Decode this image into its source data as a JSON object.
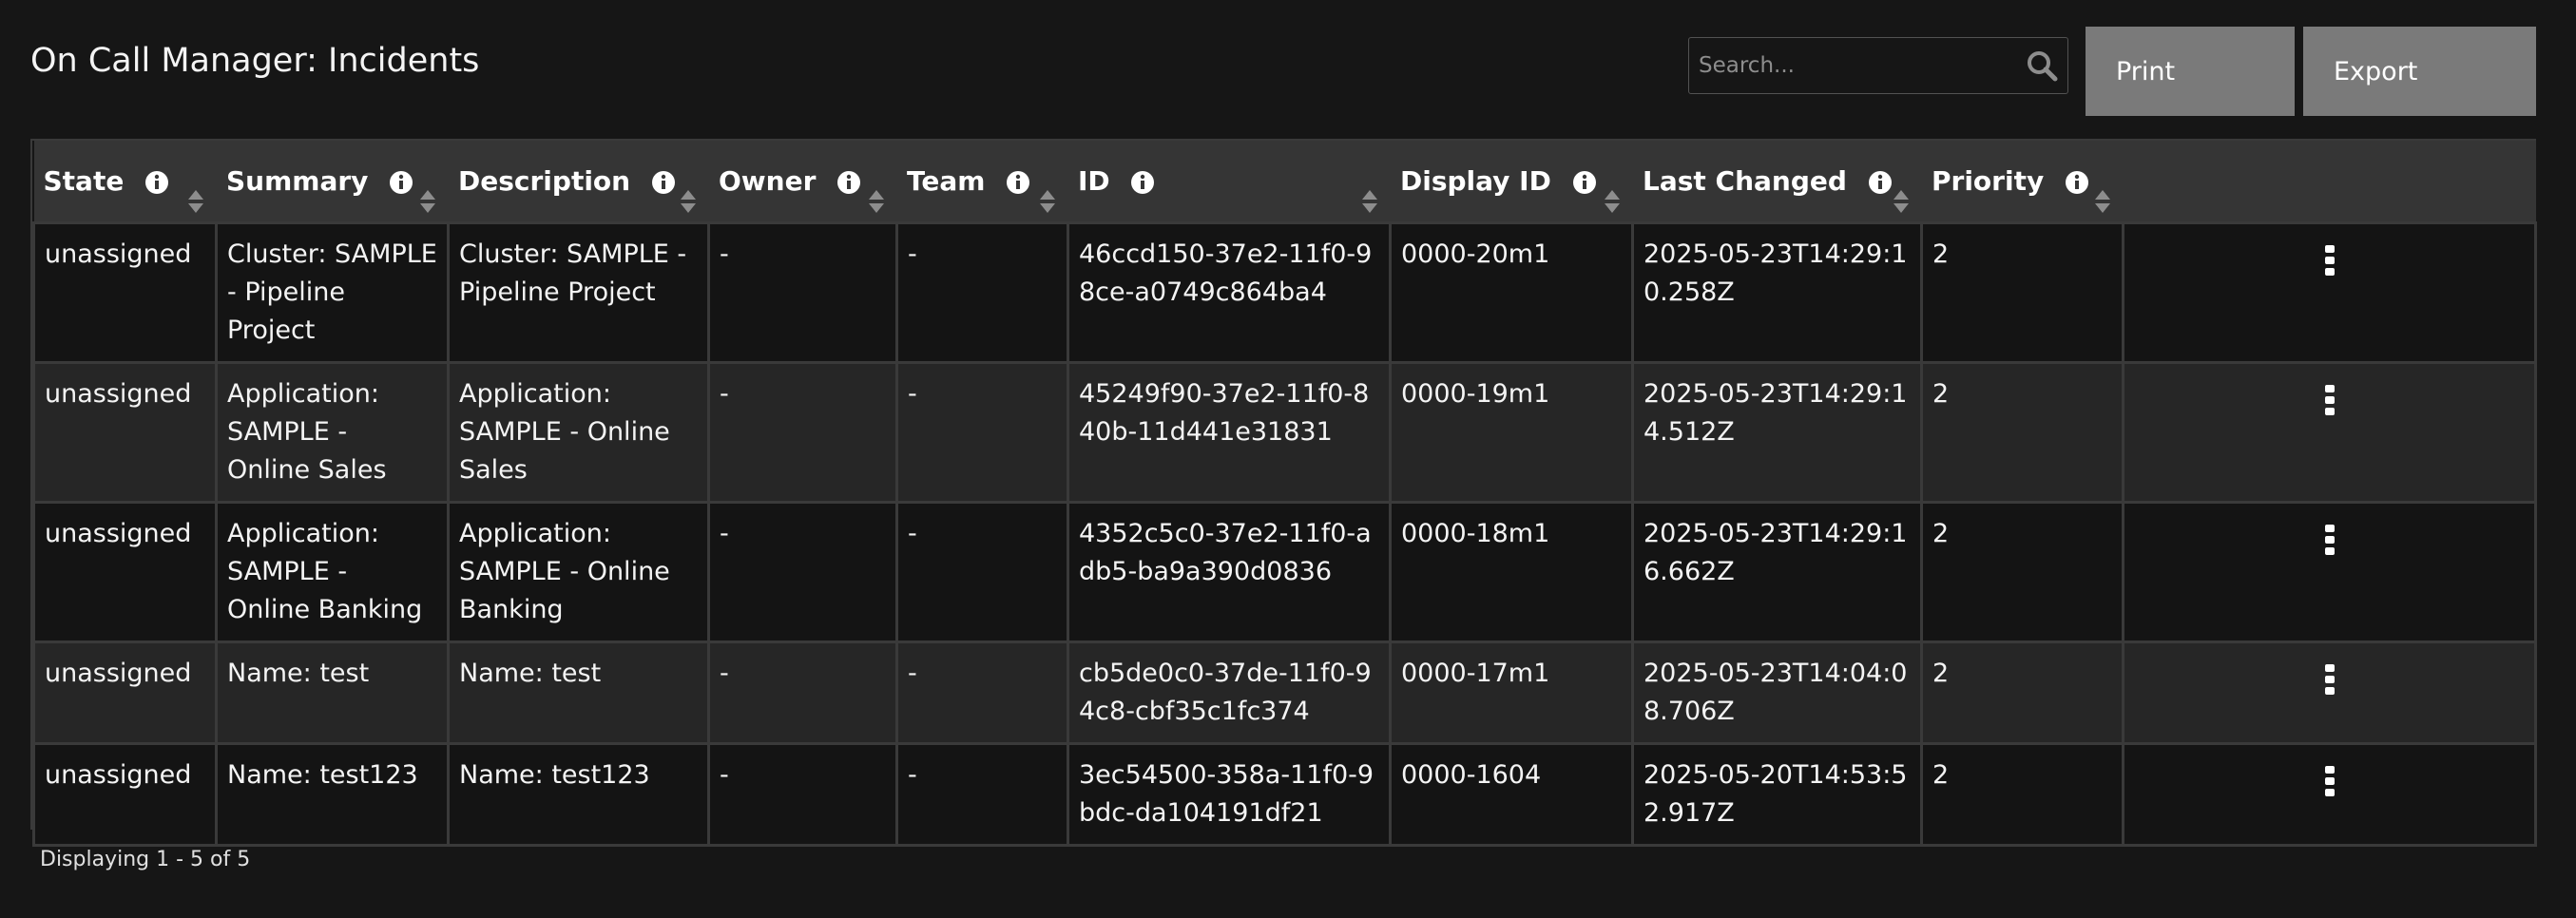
{
  "header": {
    "title": "On Call Manager: Incidents",
    "search_placeholder": "Search...",
    "print_label": "Print",
    "export_label": "Export"
  },
  "table": {
    "columns": [
      {
        "label": "State"
      },
      {
        "label": "Summary"
      },
      {
        "label": "Description"
      },
      {
        "label": "Owner"
      },
      {
        "label": "Team"
      },
      {
        "label": "ID"
      },
      {
        "label": "Display ID"
      },
      {
        "label": "Last Changed"
      },
      {
        "label": "Priority"
      }
    ],
    "rows": [
      {
        "state": "unassigned",
        "summary": "Cluster: SAMPLE - Pipeline Project",
        "description": "Cluster: SAMPLE - Pipeline Project",
        "owner": "-",
        "team": "-",
        "id": "46ccd150-37e2-11f0-98ce-a0749c864ba4",
        "display_id": "0000-20m1",
        "last_changed": "2025-05-23T14:29:10.258Z",
        "priority": "2"
      },
      {
        "state": "unassigned",
        "summary": "Application: SAMPLE - Online Sales",
        "description": "Application: SAMPLE - Online Sales",
        "owner": "-",
        "team": "-",
        "id": "45249f90-37e2-11f0-840b-11d441e31831",
        "display_id": "0000-19m1",
        "last_changed": "2025-05-23T14:29:14.512Z",
        "priority": "2"
      },
      {
        "state": "unassigned",
        "summary": "Application: SAMPLE - Online Banking",
        "description": "Application: SAMPLE - Online Banking",
        "owner": "-",
        "team": "-",
        "id": "4352c5c0-37e2-11f0-adb5-ba9a390d0836",
        "display_id": "0000-18m1",
        "last_changed": "2025-05-23T14:29:16.662Z",
        "priority": "2"
      },
      {
        "state": "unassigned",
        "summary": "Name: test",
        "description": "Name: test",
        "owner": "-",
        "team": "-",
        "id": "cb5de0c0-37de-11f0-94c8-cbf35c1fc374",
        "display_id": "0000-17m1",
        "last_changed": "2025-05-23T14:04:08.706Z",
        "priority": "2"
      },
      {
        "state": "unassigned",
        "summary": "Name: test123",
        "description": "Name: test123",
        "owner": "-",
        "team": "-",
        "id": "3ec54500-358a-11f0-9bdc-da104191df21",
        "display_id": "0000-1604",
        "last_changed": "2025-05-20T14:53:52.917Z",
        "priority": "2"
      }
    ]
  },
  "footer": {
    "displaying": "Displaying 1 - 5 of 5"
  },
  "icons": {
    "search": "search-icon",
    "info": "info-icon",
    "sort": "sort-icon",
    "row_menu": "overflow-menu-icon"
  }
}
